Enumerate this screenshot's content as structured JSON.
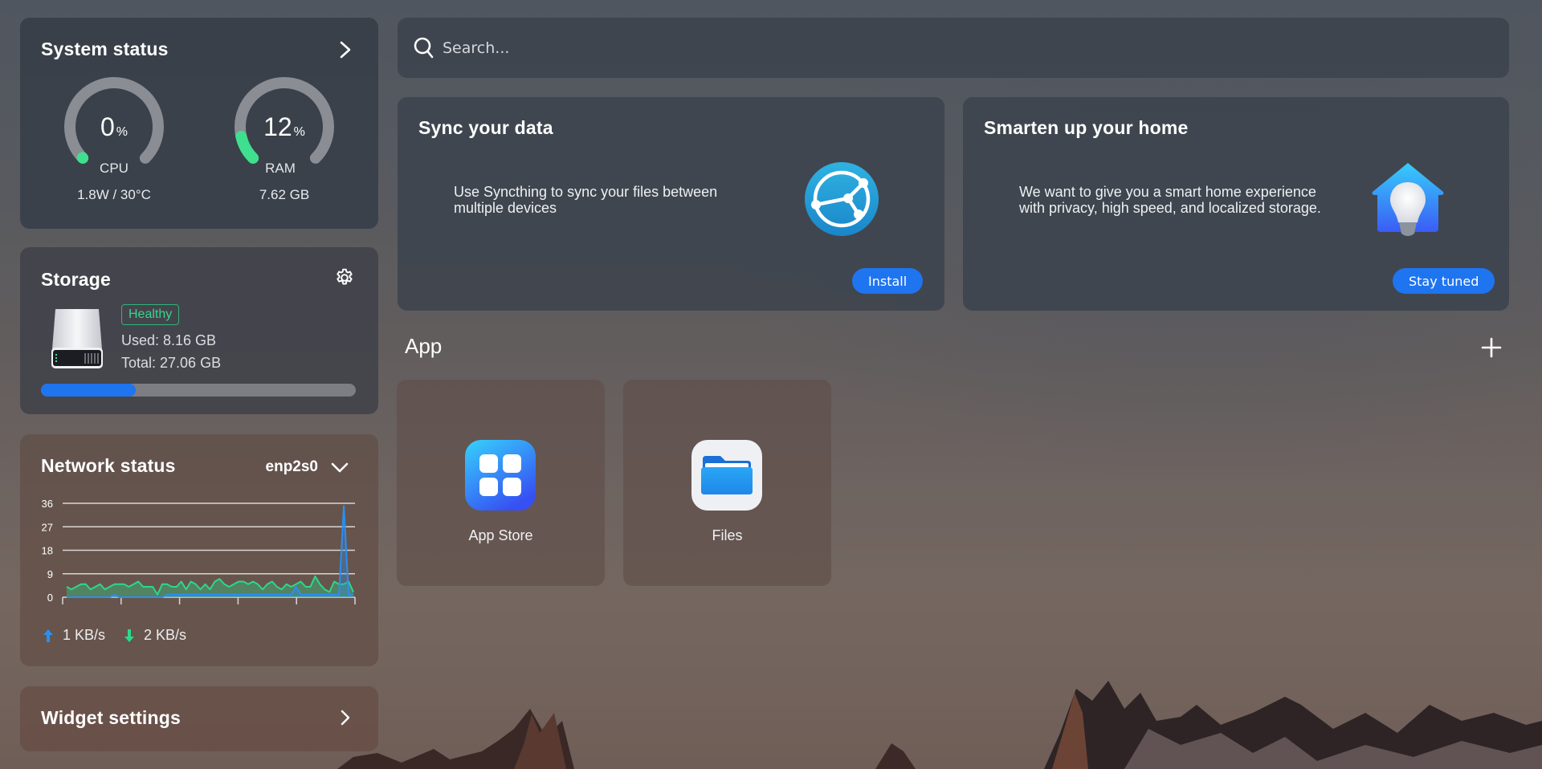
{
  "system_status": {
    "title": "System status",
    "cpu": {
      "value": "0",
      "unit": "%",
      "percent": 0,
      "label": "CPU",
      "detail": "1.8W / 30°C"
    },
    "ram": {
      "value": "12",
      "unit": "%",
      "percent": 12,
      "label": "RAM",
      "detail": "7.62 GB"
    },
    "gauge_color": "#3ee08f",
    "track_color": "#8a8d93"
  },
  "storage": {
    "title": "Storage",
    "health": "Healthy",
    "used": "Used: 8.16 GB",
    "total": "Total: 27.06 GB",
    "used_fraction": 0.3015,
    "bar_color": "#1f74f0"
  },
  "network": {
    "title": "Network status",
    "interface": "enp2s0",
    "upload": "1 KB/s",
    "download": "2 KB/s",
    "upload_color": "#2b8ff0",
    "download_color": "#2bd98a"
  },
  "widget_settings": {
    "label": "Widget settings"
  },
  "search": {
    "placeholder": "Search..."
  },
  "promos": [
    {
      "title": "Sync your data",
      "description_line1": "Use Syncthing to sync your files between",
      "description_line2": "multiple devices",
      "button": "Install"
    },
    {
      "title": "Smarten up your home",
      "description_line1": "We want to give you a smart home experience",
      "description_line2": "with privacy, high speed, and localized storage.",
      "button": "Stay tuned"
    }
  ],
  "apps": {
    "title": "App",
    "items": [
      {
        "label": "App Store",
        "icon": "app-store-icon"
      },
      {
        "label": "Files",
        "icon": "folder-icon"
      }
    ]
  },
  "chart_data": {
    "type": "area",
    "title": "",
    "xlabel": "",
    "ylabel": "",
    "ylim": [
      0,
      36
    ],
    "yticks": [
      "36",
      "27",
      "18",
      "9",
      "0"
    ],
    "ytick_values": [
      36,
      27,
      18,
      9,
      0
    ],
    "grid": true,
    "x_tick_count": 6,
    "series": [
      {
        "name": "download",
        "color": "#2bd98a",
        "values": [
          4,
          3,
          4,
          5,
          5,
          3,
          4,
          5,
          3,
          4,
          5,
          5,
          5,
          4,
          5,
          6,
          4,
          4,
          4,
          1,
          5,
          5,
          4,
          4,
          6,
          3,
          6,
          5,
          3,
          5,
          3,
          6,
          7,
          5,
          4,
          5,
          6,
          6,
          5,
          6,
          5,
          3,
          5,
          6,
          4,
          3,
          5,
          4,
          5,
          6,
          4,
          4,
          8,
          5,
          3,
          2,
          6,
          5,
          5,
          6,
          2
        ],
        "count": 61
      },
      {
        "name": "upload",
        "color": "#2b8ff0",
        "values": [
          0,
          0,
          0,
          0,
          0,
          0,
          0,
          0,
          0,
          0,
          1,
          0,
          0,
          0,
          0,
          0,
          0,
          0,
          0,
          0,
          0,
          1,
          1,
          1,
          1,
          1,
          1,
          1,
          1,
          1,
          1,
          1,
          1,
          1,
          1,
          1,
          1,
          1,
          1,
          1,
          1,
          1,
          1,
          1,
          1,
          1,
          1,
          1,
          4,
          1,
          1,
          1,
          1,
          1,
          1,
          1,
          1,
          1,
          35,
          1,
          1
        ],
        "count": 61
      }
    ]
  }
}
